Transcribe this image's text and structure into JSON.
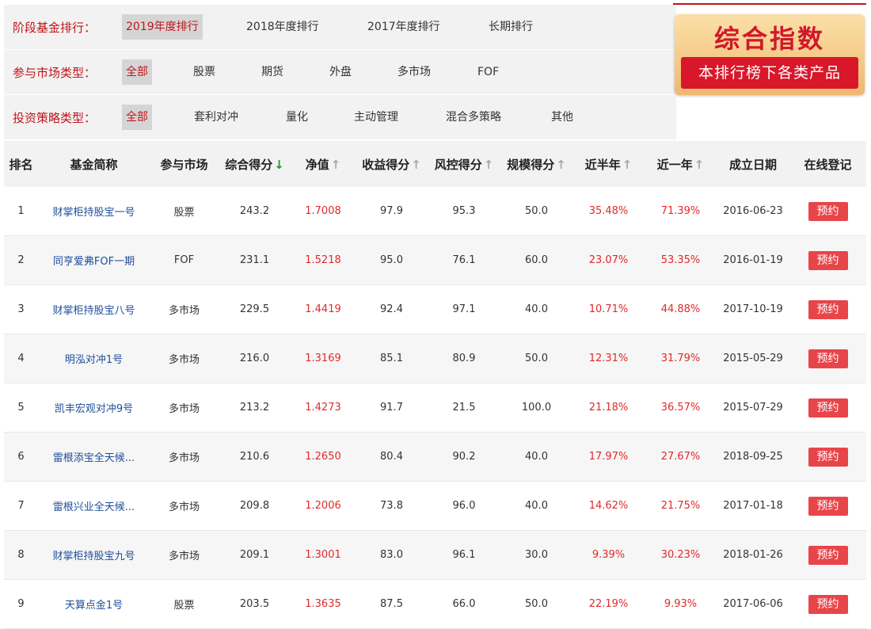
{
  "filters": {
    "period": {
      "label": "阶段基金排行：",
      "options": [
        "2019年度排行",
        "2018年度排行",
        "2017年度排行",
        "长期排行"
      ]
    },
    "market": {
      "label": "参与市场类型：",
      "options": [
        "全部",
        "股票",
        "期货",
        "外盘",
        "多市场",
        "FOF"
      ]
    },
    "strategy": {
      "label": "投资策略类型：",
      "options": [
        "全部",
        "套利对冲",
        "量化",
        "主动管理",
        "混合多策略",
        "其他"
      ]
    }
  },
  "badge": {
    "title": "综合指数",
    "subtitle": "本排行榜下各类产品"
  },
  "table": {
    "headers": [
      "排名",
      "基金简称",
      "参与市场",
      "综合得分",
      "净值",
      "收益得分",
      "风控得分",
      "规模得分",
      "近半年",
      "近一年",
      "成立日期",
      "在线登记"
    ],
    "sort_arrows": {
      "down": "↓",
      "up": "↑"
    },
    "button_label": "预约",
    "rows": [
      [
        "1",
        "财掌柜持股宝一号",
        "股票",
        "243.2",
        "1.7008",
        "97.9",
        "95.3",
        "50.0",
        "35.48%",
        "71.39%",
        "2016-06-23"
      ],
      [
        "2",
        "同亨爱弗FOF一期",
        "FOF",
        "231.1",
        "1.5218",
        "95.0",
        "76.1",
        "60.0",
        "23.07%",
        "53.35%",
        "2016-01-19"
      ],
      [
        "3",
        "财掌柜持股宝八号",
        "多市场",
        "229.5",
        "1.4419",
        "92.4",
        "97.1",
        "40.0",
        "10.71%",
        "44.88%",
        "2017-10-19"
      ],
      [
        "4",
        "明泓对冲1号",
        "多市场",
        "216.0",
        "1.3169",
        "85.1",
        "80.9",
        "50.0",
        "12.31%",
        "31.79%",
        "2015-05-29"
      ],
      [
        "5",
        "凯丰宏观对冲9号",
        "多市场",
        "213.2",
        "1.4273",
        "91.7",
        "21.5",
        "100.0",
        "21.18%",
        "36.57%",
        "2015-07-29"
      ],
      [
        "6",
        "雷根添宝全天候...",
        "多市场",
        "210.6",
        "1.2650",
        "80.4",
        "90.2",
        "40.0",
        "17.97%",
        "27.67%",
        "2018-09-25"
      ],
      [
        "7",
        "雷根兴业全天候...",
        "多市场",
        "209.8",
        "1.2006",
        "73.8",
        "96.0",
        "40.0",
        "14.62%",
        "21.75%",
        "2017-01-18"
      ],
      [
        "8",
        "财掌柜持股宝九号",
        "多市场",
        "209.1",
        "1.3001",
        "83.0",
        "96.1",
        "30.0",
        "9.39%",
        "30.23%",
        "2018-01-26"
      ],
      [
        "9",
        "天算点金1号",
        "股票",
        "203.5",
        "1.3635",
        "87.5",
        "66.0",
        "50.0",
        "22.19%",
        "9.93%",
        "2017-06-06"
      ]
    ]
  }
}
